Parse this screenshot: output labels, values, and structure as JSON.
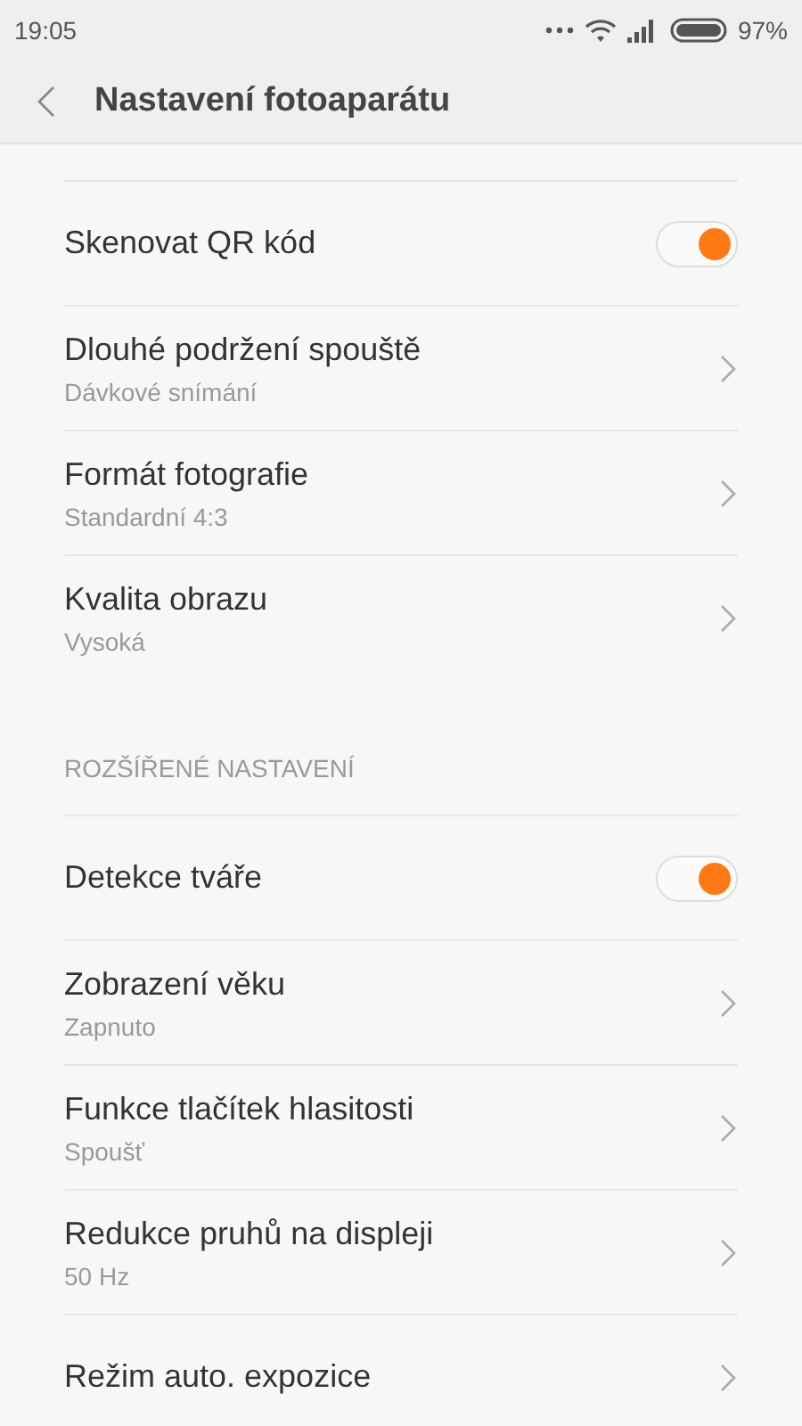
{
  "status_bar": {
    "time": "19:05",
    "battery": "97%"
  },
  "header": {
    "title": "Nastavení fotoaparátu"
  },
  "groups": [
    {
      "items": [
        {
          "kind": "toggle",
          "title": "Skenovat QR kód",
          "on": true
        },
        {
          "kind": "link",
          "title": "Dlouhé podržení spouště",
          "subtitle": "Dávkové snímání"
        },
        {
          "kind": "link",
          "title": "Formát fotografie",
          "subtitle": "Standardní 4:3"
        },
        {
          "kind": "link",
          "title": "Kvalita obrazu",
          "subtitle": "Vysoká"
        }
      ]
    },
    {
      "heading": "ROZŠÍŘENÉ NASTAVENÍ",
      "items": [
        {
          "kind": "toggle",
          "title": "Detekce tváře",
          "on": true
        },
        {
          "kind": "link",
          "title": "Zobrazení věku",
          "subtitle": "Zapnuto"
        },
        {
          "kind": "link",
          "title": "Funkce tlačítek hlasitosti",
          "subtitle": "Spoušť"
        },
        {
          "kind": "link",
          "title": "Redukce pruhů na displeji",
          "subtitle": "50 Hz"
        },
        {
          "kind": "link",
          "title": "Režim auto. expozice"
        }
      ]
    }
  ]
}
